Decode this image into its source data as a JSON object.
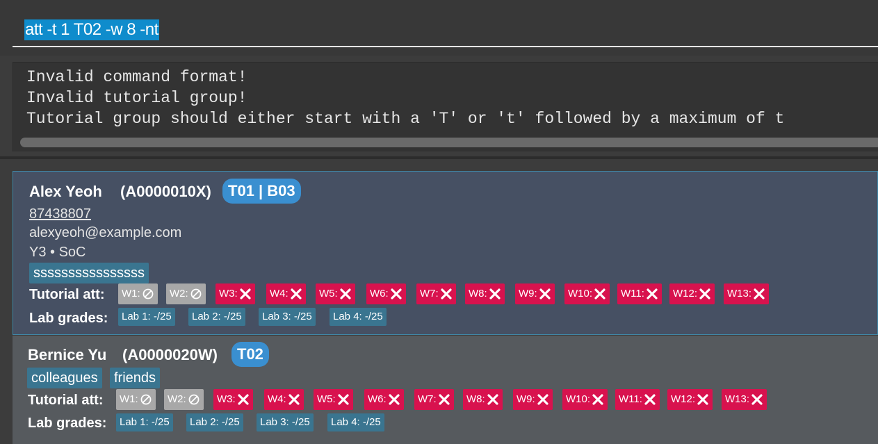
{
  "command_box": {
    "value": "att -t 1 T02 -w 8 -nt"
  },
  "result_box": {
    "lines": [
      "Invalid command format!",
      "Invalid tutorial group!",
      "Tutorial group should either start with a 'T' or 't' followed by a maximum of t"
    ]
  },
  "persons": [
    {
      "name": "Alex Yeoh",
      "student_id": "(A0000010X)",
      "group": "T01 | B03",
      "phone": "87438807",
      "email": "alexyeoh@example.com",
      "year_faculty": "Y3 • SoC",
      "tags": [
        "ssssssssssssssss"
      ],
      "tutorial_label": "Tutorial att:",
      "lab_label": "Lab grades:",
      "attendance": [
        {
          "week": "W1:",
          "status": "no-class"
        },
        {
          "week": "W2:",
          "status": "no-class"
        },
        {
          "week": "W3:",
          "status": "absent"
        },
        {
          "week": "W4:",
          "status": "absent"
        },
        {
          "week": "W5:",
          "status": "absent"
        },
        {
          "week": "W6:",
          "status": "absent"
        },
        {
          "week": "W7:",
          "status": "absent"
        },
        {
          "week": "W8:",
          "status": "absent"
        },
        {
          "week": "W9:",
          "status": "absent"
        },
        {
          "week": "W10:",
          "status": "absent"
        },
        {
          "week": "W11:",
          "status": "absent"
        },
        {
          "week": "W12:",
          "status": "absent"
        },
        {
          "week": "W13:",
          "status": "absent"
        }
      ],
      "labs": [
        "Lab 1: -/25",
        "Lab 2: -/25",
        "Lab 3: -/25",
        "Lab 4: -/25"
      ]
    },
    {
      "name": "Bernice Yu",
      "student_id": "(A0000020W)",
      "group": "T02",
      "tags": [
        "colleagues",
        "friends"
      ],
      "tutorial_label": "Tutorial att:",
      "lab_label": "Lab grades:",
      "attendance": [
        {
          "week": "W1:",
          "status": "no-class"
        },
        {
          "week": "W2:",
          "status": "no-class"
        },
        {
          "week": "W3:",
          "status": "absent"
        },
        {
          "week": "W4:",
          "status": "absent"
        },
        {
          "week": "W5:",
          "status": "absent"
        },
        {
          "week": "W6:",
          "status": "absent"
        },
        {
          "week": "W7:",
          "status": "absent"
        },
        {
          "week": "W8:",
          "status": "absent"
        },
        {
          "week": "W9:",
          "status": "absent"
        },
        {
          "week": "W10:",
          "status": "absent"
        },
        {
          "week": "W11:",
          "status": "absent"
        },
        {
          "week": "W12:",
          "status": "absent"
        },
        {
          "week": "W13:",
          "status": "absent"
        }
      ],
      "labs": [
        "Lab 1: -/25",
        "Lab 2: -/25",
        "Lab 3: -/25",
        "Lab 4: -/25"
      ]
    }
  ],
  "colors": {
    "absent": "#d8124e",
    "no_class": "#a8a8a8",
    "group_badge": "#3a8fd0",
    "tag": "#3a7590",
    "selection": "#0f8ccc"
  },
  "icons": {
    "absent": "cross-icon",
    "no_class": "no-entry-icon"
  }
}
